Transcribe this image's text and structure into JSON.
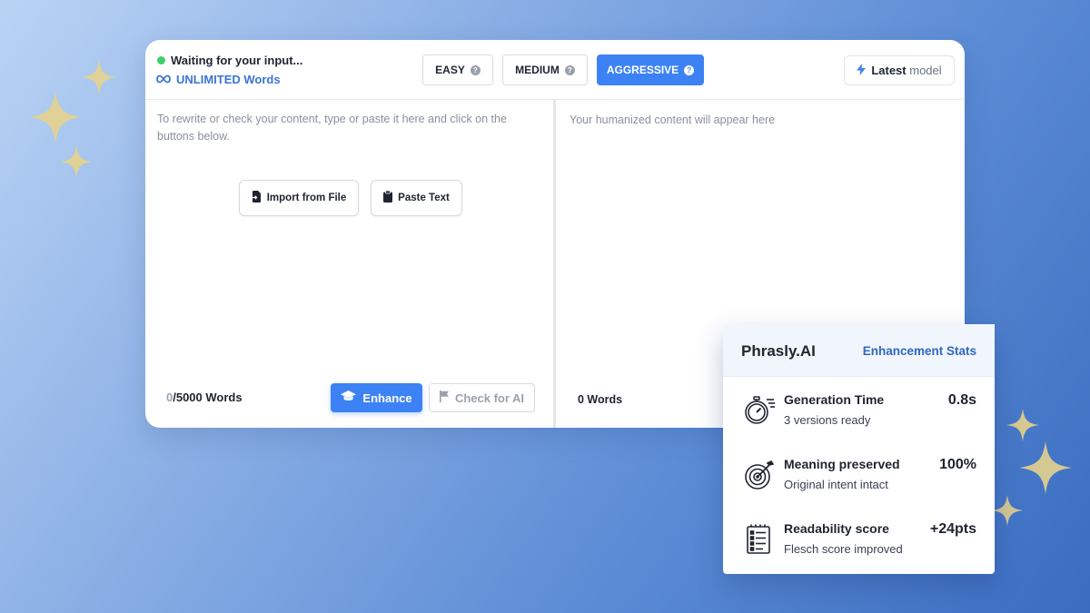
{
  "header": {
    "status_text": "Waiting for your input...",
    "words_label": "UNLIMITED Words"
  },
  "modes": {
    "easy": "EASY",
    "medium": "MEDIUM",
    "aggressive": "AGGRESSIVE",
    "help_glyph": "?",
    "selected": "AGGRESSIVE"
  },
  "model": {
    "label_bold": "Latest",
    "label_rest": "model"
  },
  "input": {
    "placeholder": "To rewrite or check your content, type or paste it here and click on the buttons below.",
    "import_label": "Import from File",
    "paste_label": "Paste Text",
    "word_count_current": "0",
    "word_count_limit": "/5000 Words",
    "enhance_label": "Enhance",
    "check_label": "Check for AI"
  },
  "output": {
    "placeholder": "Your humanized content will appear here",
    "word_count": "0 Words"
  },
  "stats": {
    "brand": "Phrasly.AI",
    "title": "Enhancement Stats",
    "items": [
      {
        "name": "Generation Time",
        "sub": "3 versions ready",
        "value": "0.8s",
        "icon": "stopwatch-icon"
      },
      {
        "name": "Meaning preserved",
        "sub": "Original intent intact",
        "value": "100%",
        "icon": "target-icon"
      },
      {
        "name": "Readability score",
        "sub": "Flesch score improved",
        "value": "+24pts",
        "icon": "checklist-icon"
      }
    ]
  },
  "colors": {
    "accent": "#3d82f4",
    "status_dot": "#3ecf6a",
    "link": "#3b74d6",
    "sparkle": "#e6d28c"
  }
}
